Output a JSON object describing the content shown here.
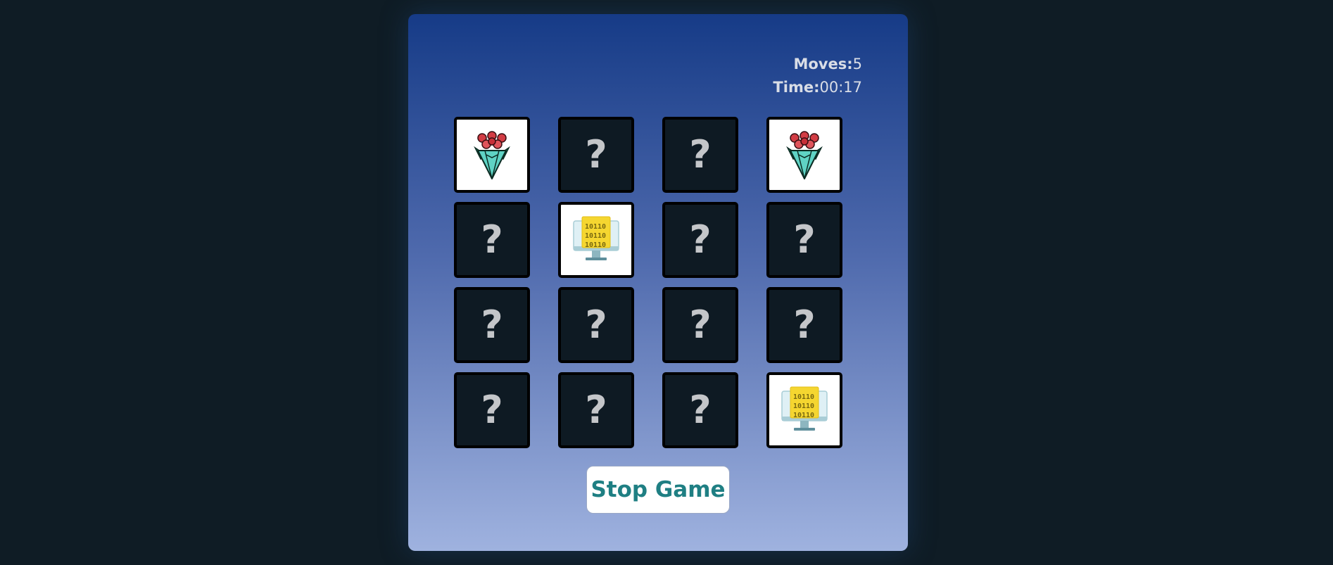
{
  "stats": {
    "moves_label": "Moves:",
    "moves_value": "5",
    "time_label": "Time:",
    "time_value": "00:17"
  },
  "cards": [
    {
      "state": "flipped",
      "icon": "bouquet-icon"
    },
    {
      "state": "hidden",
      "label": "?"
    },
    {
      "state": "hidden",
      "label": "?"
    },
    {
      "state": "flipped",
      "icon": "bouquet-icon"
    },
    {
      "state": "hidden",
      "label": "?"
    },
    {
      "state": "flipped",
      "icon": "binary-monitor-icon",
      "icon_text": [
        "10110",
        "10110",
        "10110"
      ]
    },
    {
      "state": "hidden",
      "label": "?"
    },
    {
      "state": "hidden",
      "label": "?"
    },
    {
      "state": "hidden",
      "label": "?"
    },
    {
      "state": "hidden",
      "label": "?"
    },
    {
      "state": "hidden",
      "label": "?"
    },
    {
      "state": "hidden",
      "label": "?"
    },
    {
      "state": "hidden",
      "label": "?"
    },
    {
      "state": "hidden",
      "label": "?"
    },
    {
      "state": "hidden",
      "label": "?"
    },
    {
      "state": "flipped",
      "icon": "binary-monitor-icon",
      "icon_text": [
        "10110",
        "10110",
        "10110"
      ]
    }
  ],
  "controls": {
    "stop_label": "Stop Game"
  }
}
